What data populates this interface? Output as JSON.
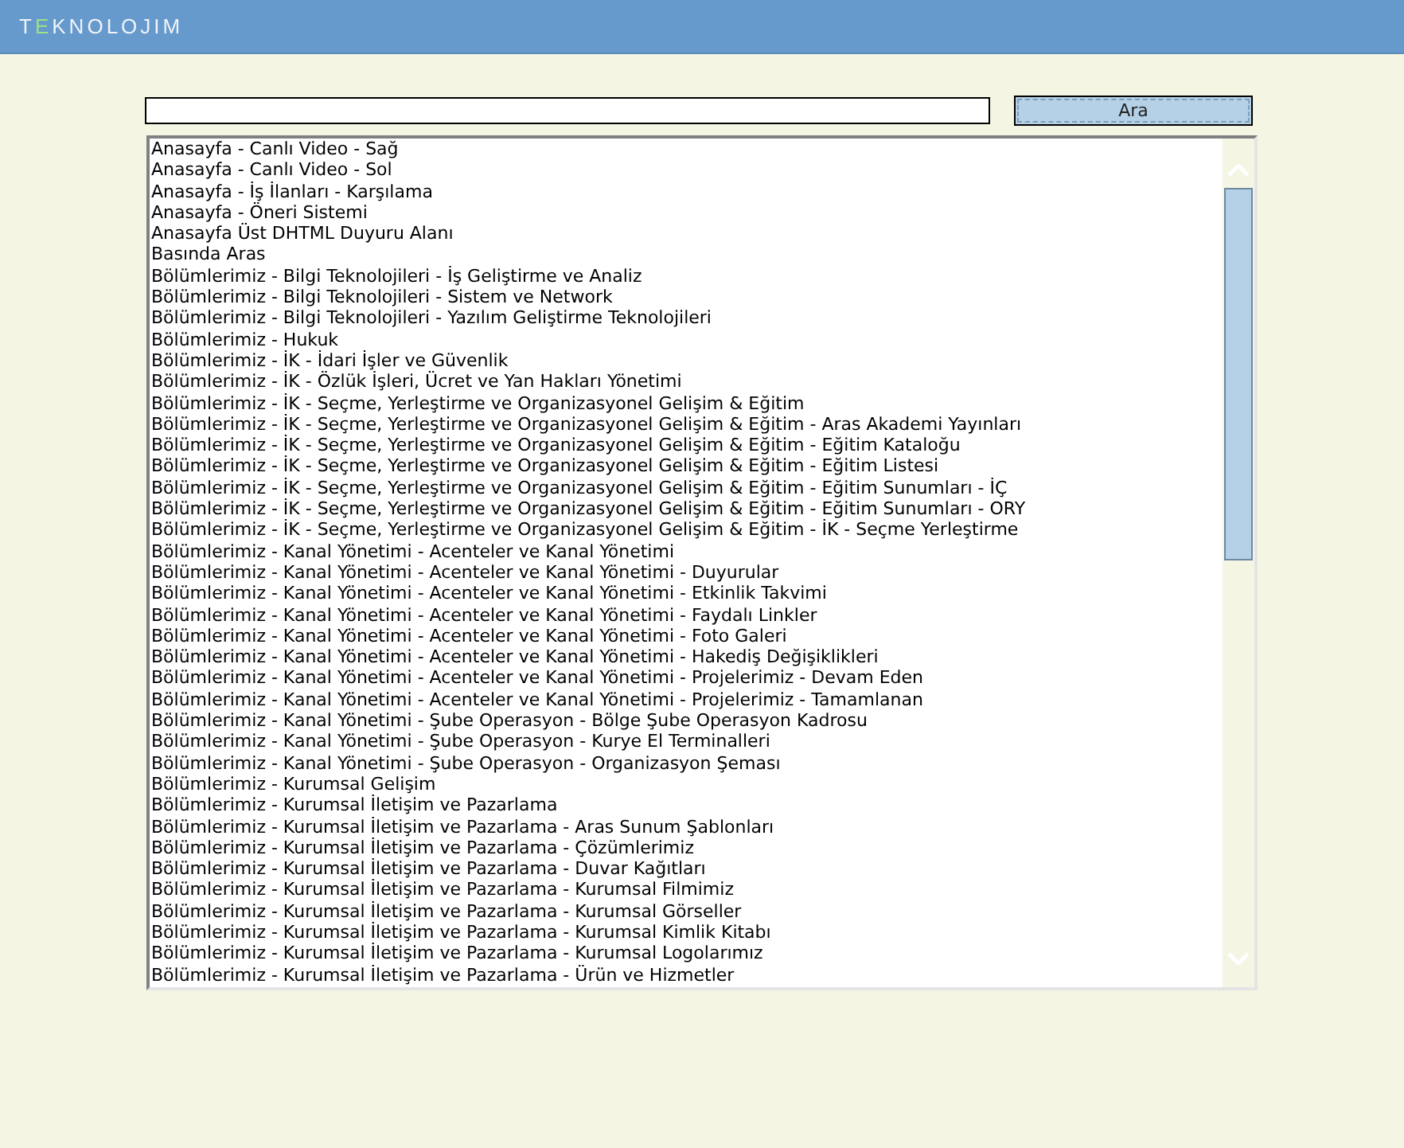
{
  "header": {
    "logo": "TEKNOLOJIM"
  },
  "search": {
    "button": "Ara"
  },
  "list": {
    "items": [
      "Anasayfa - Canlı Video - Sağ",
      "Anasayfa - Canlı Video - Sol",
      "Anasayfa - İş İlanları - Karşılama",
      "Anasayfa - Öneri Sistemi",
      "Anasayfa Üst DHTML Duyuru Alanı",
      "Basında Aras",
      "Bölümlerimiz - Bilgi Teknolojileri - İş Geliştirme ve Analiz",
      "Bölümlerimiz - Bilgi Teknolojileri - Sistem ve Network",
      "Bölümlerimiz - Bilgi Teknolojileri - Yazılım Geliştirme Teknolojileri",
      "Bölümlerimiz - Hukuk",
      "Bölümlerimiz - İK - İdari İşler ve Güvenlik",
      "Bölümlerimiz - İK - Özlük İşleri, Ücret ve Yan Hakları Yönetimi",
      "Bölümlerimiz - İK - Seçme, Yerleştirme ve Organizasyonel Gelişim & Eğitim",
      "Bölümlerimiz - İK - Seçme, Yerleştirme ve Organizasyonel Gelişim & Eğitim - Aras Akademi Yayınları",
      "Bölümlerimiz - İK - Seçme, Yerleştirme ve Organizasyonel Gelişim & Eğitim - Eğitim Kataloğu",
      "Bölümlerimiz - İK - Seçme, Yerleştirme ve Organizasyonel Gelişim & Eğitim - Eğitim Listesi",
      "Bölümlerimiz - İK - Seçme, Yerleştirme ve Organizasyonel Gelişim & Eğitim - Eğitim Sunumları - İÇ",
      "Bölümlerimiz - İK - Seçme, Yerleştirme ve Organizasyonel Gelişim & Eğitim - Eğitim Sunumları - ORY",
      "Bölümlerimiz - İK - Seçme, Yerleştirme ve Organizasyonel Gelişim & Eğitim - İK - Seçme Yerleştirme",
      "Bölümlerimiz - Kanal Yönetimi - Acenteler ve Kanal Yönetimi",
      "Bölümlerimiz - Kanal Yönetimi - Acenteler ve Kanal Yönetimi - Duyurular",
      "Bölümlerimiz - Kanal Yönetimi - Acenteler ve Kanal Yönetimi - Etkinlik Takvimi",
      "Bölümlerimiz - Kanal Yönetimi - Acenteler ve Kanal Yönetimi - Faydalı Linkler",
      "Bölümlerimiz - Kanal Yönetimi - Acenteler ve Kanal Yönetimi - Foto Galeri",
      "Bölümlerimiz - Kanal Yönetimi - Acenteler ve Kanal Yönetimi - Hakediş Değişiklikleri",
      "Bölümlerimiz - Kanal Yönetimi - Acenteler ve Kanal Yönetimi - Projelerimiz - Devam Eden",
      "Bölümlerimiz - Kanal Yönetimi - Acenteler ve Kanal Yönetimi - Projelerimiz - Tamamlanan",
      "Bölümlerimiz - Kanal Yönetimi - Şube Operasyon - Bölge Şube Operasyon Kadrosu",
      "Bölümlerimiz - Kanal Yönetimi - Şube Operasyon - Kurye El Terminalleri",
      "Bölümlerimiz - Kanal Yönetimi - Şube Operasyon - Organizasyon Şeması",
      "Bölümlerimiz - Kurumsal Gelişim",
      "Bölümlerimiz - Kurumsal İletişim ve Pazarlama",
      "Bölümlerimiz - Kurumsal İletişim ve Pazarlama - Aras Sunum Şablonları",
      "Bölümlerimiz - Kurumsal İletişim ve Pazarlama - Çözümlerimiz",
      "Bölümlerimiz - Kurumsal İletişim ve Pazarlama - Duvar Kağıtları",
      "Bölümlerimiz - Kurumsal İletişim ve Pazarlama - Kurumsal Filmimiz",
      "Bölümlerimiz - Kurumsal İletişim ve Pazarlama - Kurumsal Görseller",
      "Bölümlerimiz - Kurumsal İletişim ve Pazarlama - Kurumsal Kimlik Kitabı",
      "Bölümlerimiz - Kurumsal İletişim ve Pazarlama - Kurumsal Logolarımız",
      "Bölümlerimiz - Kurumsal İletişim ve Pazarlama - Ürün ve Hizmetler"
    ]
  }
}
